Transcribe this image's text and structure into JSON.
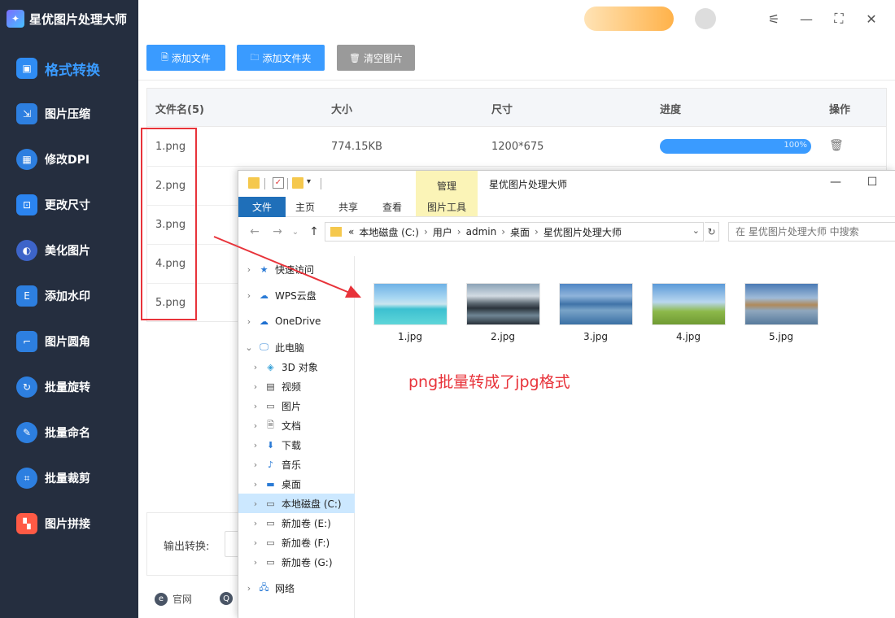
{
  "app": {
    "title": "星优图片处理大师",
    "logo_glyph": "✦"
  },
  "sidebar": {
    "items": [
      {
        "label": "格式转换",
        "icon": "image-convert-icon",
        "glyph": "▣",
        "active": true
      },
      {
        "label": "图片压缩",
        "icon": "image-compress-icon",
        "glyph": "⇲"
      },
      {
        "label": "修改DPI",
        "icon": "dpi-icon",
        "glyph": "▦"
      },
      {
        "label": "更改尺寸",
        "icon": "resize-icon",
        "glyph": "⊡"
      },
      {
        "label": "美化图片",
        "icon": "beautify-icon",
        "glyph": "◐"
      },
      {
        "label": "添加水印",
        "icon": "watermark-icon",
        "glyph": "E"
      },
      {
        "label": "图片圆角",
        "icon": "rounded-corner-icon",
        "glyph": "⌐"
      },
      {
        "label": "批量旋转",
        "icon": "rotate-icon",
        "glyph": "↻"
      },
      {
        "label": "批量命名",
        "icon": "rename-icon",
        "glyph": "✎"
      },
      {
        "label": "批量裁剪",
        "icon": "crop-icon",
        "glyph": "⌗"
      },
      {
        "label": "图片拼接",
        "icon": "stitch-icon",
        "glyph": "▚"
      }
    ]
  },
  "topbar": {
    "settings_glyph": "⚟",
    "minimize_glyph": "—",
    "maximize_glyph": "⛶",
    "close_glyph": "✕"
  },
  "toolbar": {
    "add_file_label": "添加文件",
    "add_folder_label": "添加文件夹",
    "clear_label": "清空图片",
    "add_file_glyph": "🗎",
    "add_folder_glyph": "🗀",
    "clear_glyph": "🗑"
  },
  "table": {
    "headers": [
      "文件名(5)",
      "大小",
      "尺寸",
      "进度",
      "操作"
    ],
    "rows": [
      {
        "name": "1.png",
        "size": "774.15KB",
        "dims": "1200*675",
        "progress_pct": 100,
        "progress_text": "100%"
      },
      {
        "name": "2.png"
      },
      {
        "name": "3.png"
      },
      {
        "name": "4.png"
      },
      {
        "name": "5.png"
      }
    ],
    "delete_glyph": "🗑"
  },
  "output": {
    "label": "输出转换:"
  },
  "footer": {
    "site_label": "官网",
    "site_glyph": "e",
    "support_glyph": "Q"
  },
  "explorer": {
    "context_tab": "管理",
    "title": "星优图片处理大师",
    "ribbon_tabs": [
      "文件",
      "主页",
      "共享",
      "查看",
      "图片工具"
    ],
    "back_glyph": "←",
    "forward_glyph": "→",
    "history_glyph": "⌄",
    "up_glyph": "↑",
    "breadcrumb": [
      "本地磁盘 (C:)",
      "用户",
      "admin",
      "桌面",
      "星优图片处理大师"
    ],
    "breadcrumb_prefix": "«",
    "breadcrumb_sep": "›",
    "dropdown_glyph": "⌄",
    "refresh_glyph": "↻",
    "search_placeholder": "在 星优图片处理大师 中搜索",
    "min_glyph": "—",
    "max_glyph": "☐",
    "tree": [
      {
        "label": "快速访问",
        "icon": "star-icon",
        "glyph": "★",
        "color": "#2b7bd6",
        "chev": "›",
        "indent": 0
      },
      {
        "label": "WPS云盘",
        "icon": "cloud-icon",
        "glyph": "☁",
        "color": "#2b7bd6",
        "chev": "›",
        "indent": 0
      },
      {
        "label": "OneDrive",
        "icon": "onedrive-icon",
        "glyph": "☁",
        "color": "#1e6fd0",
        "chev": "›",
        "indent": 0
      },
      {
        "label": "此电脑",
        "icon": "pc-icon",
        "glyph": "🖵",
        "color": "#3a8ad9",
        "chev": "⌄",
        "indent": 0
      },
      {
        "label": "3D 对象",
        "icon": "3d-icon",
        "glyph": "◈",
        "color": "#3aa3d9",
        "chev": "›",
        "indent": 1
      },
      {
        "label": "视频",
        "icon": "video-icon",
        "glyph": "▤",
        "color": "#444",
        "chev": "›",
        "indent": 1
      },
      {
        "label": "图片",
        "icon": "pictures-icon",
        "glyph": "▭",
        "color": "#555",
        "chev": "›",
        "indent": 1
      },
      {
        "label": "文档",
        "icon": "documents-icon",
        "glyph": "🗎",
        "color": "#666",
        "chev": "›",
        "indent": 1
      },
      {
        "label": "下载",
        "icon": "download-icon",
        "glyph": "⬇",
        "color": "#2b7bd6",
        "chev": "›",
        "indent": 1
      },
      {
        "label": "音乐",
        "icon": "music-icon",
        "glyph": "♪",
        "color": "#2b7bd6",
        "chev": "›",
        "indent": 1
      },
      {
        "label": "桌面",
        "icon": "desktop-icon",
        "glyph": "▬",
        "color": "#2b7bd6",
        "chev": "›",
        "indent": 1
      },
      {
        "label": "本地磁盘 (C:)",
        "icon": "drive-c-icon",
        "glyph": "▭",
        "color": "#555",
        "chev": "›",
        "indent": 1,
        "selected": true
      },
      {
        "label": "新加卷 (E:)",
        "icon": "drive-e-icon",
        "glyph": "▭",
        "color": "#555",
        "chev": "›",
        "indent": 1
      },
      {
        "label": "新加卷 (F:)",
        "icon": "drive-f-icon",
        "glyph": "▭",
        "color": "#555",
        "chev": "›",
        "indent": 1
      },
      {
        "label": "新加卷 (G:)",
        "icon": "drive-g-icon",
        "glyph": "▭",
        "color": "#555",
        "chev": "›",
        "indent": 1
      },
      {
        "label": "网络",
        "icon": "network-icon",
        "glyph": "🖧",
        "color": "#2b7bd6",
        "chev": "›",
        "indent": 0
      }
    ],
    "files": [
      "1.jpg",
      "2.jpg",
      "3.jpg",
      "4.jpg",
      "5.jpg"
    ]
  },
  "annotation": {
    "text": "png批量转成了jpg格式",
    "color": "#e8333a"
  },
  "colors": {
    "accent": "#3a9bff",
    "sidebar_bg": "#252e3f",
    "highlight_red": "#e8333a"
  }
}
